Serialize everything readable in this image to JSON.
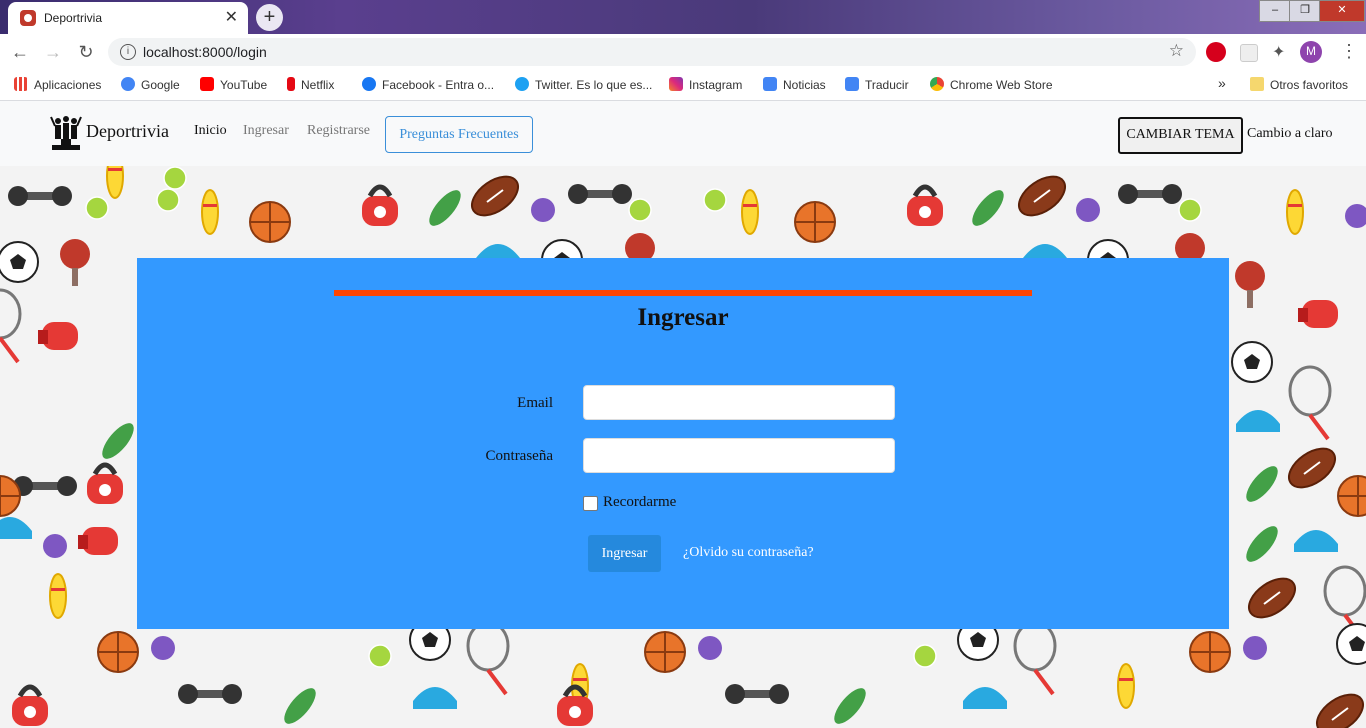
{
  "browser": {
    "tab_title": "Deportrivia",
    "tab_close": "✕",
    "new_tab": "+",
    "url": "localhost:8000/login",
    "profile_initial": "M",
    "window_controls": [
      "–",
      "❐",
      "✕"
    ],
    "bookmarks": [
      {
        "label": "Aplicaciones",
        "icon": "apps-grid-icon",
        "color": "#e94235"
      },
      {
        "label": "Google",
        "icon": "google-icon",
        "color": "#4285f4"
      },
      {
        "label": "YouTube",
        "icon": "youtube-icon",
        "color": "#ff0000"
      },
      {
        "label": "Netflix",
        "icon": "netflix-icon",
        "color": "#e50914"
      },
      {
        "label": "Facebook - Entra o...",
        "icon": "facebook-icon",
        "color": "#1877f2"
      },
      {
        "label": "Twitter. Es lo que es...",
        "icon": "twitter-icon",
        "color": "#1da1f2"
      },
      {
        "label": "Instagram",
        "icon": "instagram-icon",
        "color": "#c13584"
      },
      {
        "label": "Noticias",
        "icon": "news-icon",
        "color": "#4285f4"
      },
      {
        "label": "Traducir",
        "icon": "translate-icon",
        "color": "#4285f4"
      },
      {
        "label": "Chrome Web Store",
        "icon": "webstore-icon",
        "color": "#34a853"
      }
    ],
    "bookmarks_overflow": "»",
    "other_bookmarks": "Otros favoritos"
  },
  "navbar": {
    "brand": "Deportrivia",
    "links": [
      "Inicio",
      "Ingresar",
      "Registrarse"
    ],
    "faq_button": "Preguntas Frecuentes",
    "theme_button": "CAMBIAR TEMA",
    "theme_label": "Cambio a claro"
  },
  "login": {
    "title": "Ingresar",
    "email_label": "Email",
    "email_value": "",
    "password_label": "Contraseña",
    "password_value": "",
    "remember_label": "Recordarme",
    "submit_label": "Ingresar",
    "forgot_link": "¿Olvido su contraseña?"
  },
  "colors": {
    "card": "#3399ff",
    "accent_line": "#ff4500",
    "submit": "#2589dd",
    "faq_outline": "#3a8fd9"
  }
}
